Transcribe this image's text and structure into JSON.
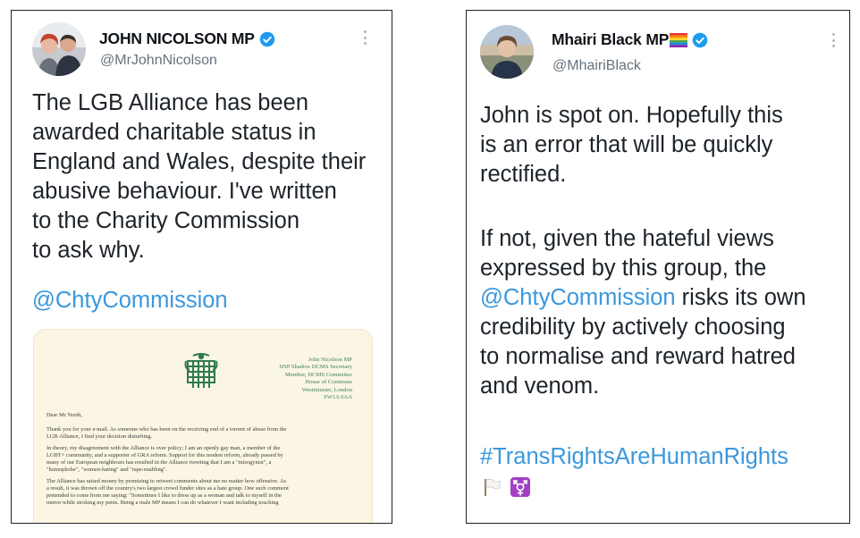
{
  "tweets": [
    {
      "author": "JOHN NICOLSON MP",
      "handle": "@MrJohnNicolson",
      "lines": [
        "The LGB Alliance has been",
        "awarded charitable status in",
        "England and Wales, despite their",
        "abusive behaviour. I've written",
        "to the Charity Commission",
        "to ask why."
      ],
      "mention": "@ChtyCommission",
      "letter": {
        "address": [
          "John Nicolson MP",
          "SNP Shadow DCMS Secretary",
          "Member, DCMS Committee",
          "House of Commons",
          "Westminster, London",
          "SW1A 0AA"
        ],
        "salutation": "Dear Mr North,",
        "p1": [
          "Thank you for your e-mail. As someone who has been on the receiving end of a torrent of abuse from the",
          "LGB Alliance, I find your decision disturbing."
        ],
        "p2": [
          "In theory, my disagreement with the Alliance is over policy; I am an openly gay man, a member of the",
          "LGBT+ community, and a supporter of GRA reform. Support for this modest reform, already passed by",
          "many of our European neighbours has resulted in the Alliance tweeting that I am a \"misogynist\", a",
          "\"homophobe\", \"women-hating\" and \"rape-enabling\"."
        ],
        "p3": [
          "The Alliance has raised money by promising to retweet comments about me no matter how offensive. As",
          "a result, it was thrown off the country's two largest crowd funder sites as a hate group. One such comment",
          "pretended to come from me saying: \"Sometimes I like to dress up as a woman and talk to myself in the",
          "mirror while stroking my penis. Being a male MP means I can do whatever I want including touching"
        ]
      }
    },
    {
      "author": "Mhairi Black MP",
      "handle": "@MhairiBlack",
      "lines1": [
        "John is spot on. Hopefully this",
        "is an error that will be quickly",
        "rectified."
      ],
      "lines2a": [
        "If not, given the hateful views",
        "expressed by this group, the"
      ],
      "mention": "@ChtyCommission",
      "after_mention": " risks its own",
      "lines2b": [
        "credibility by actively choosing",
        "to normalise and reward hatred",
        "and venom."
      ],
      "hashtag": "#TransRightsAreHumanRights"
    }
  ],
  "colors": {
    "link": "#3b98dc",
    "verified": "#1d9bf0",
    "letter_bg": "#fbf6e4",
    "letter_crest": "#2f7a4c"
  },
  "icons": [
    "verified-badge-icon",
    "more-options-icon",
    "rainbow-flag-icon",
    "white-flag-icon",
    "transgender-symbol-icon",
    "portcullis-crest-icon"
  ]
}
